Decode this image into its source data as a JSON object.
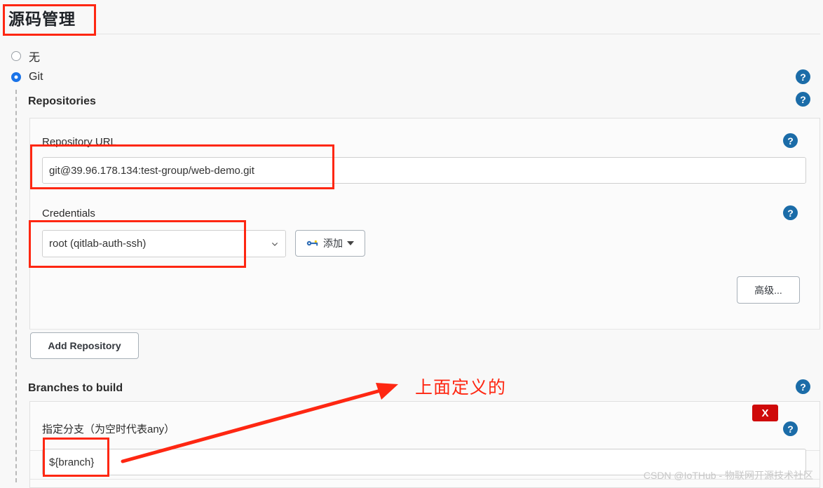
{
  "page": {
    "title": "源码管理",
    "watermark": "CSDN @IoTHub - 物联网开源技术社区"
  },
  "scm_options": [
    {
      "label": "无",
      "checked": false
    },
    {
      "label": "Git",
      "checked": true
    }
  ],
  "git": {
    "repositories_label": "Repositories",
    "repository": {
      "url_label": "Repository URL",
      "url_value": "git@39.96.178.134:test-group/web-demo.git",
      "credentials_label": "Credentials",
      "credentials_value": "root (qitlab-auth-ssh)",
      "add_credentials_label": "添加",
      "advanced_label": "高级...",
      "add_repository_label": "Add Repository"
    },
    "branches": {
      "section_label": "Branches to build",
      "branch_spec_label": "指定分支（为空时代表any）",
      "branch_spec_value": "${branch}",
      "delete_label": "X"
    }
  },
  "annotations": {
    "note_text": "上面定义的"
  },
  "icons": {
    "help": "?",
    "key": "key-icon",
    "caret": "chevron-down-icon"
  },
  "colors": {
    "accent": "#1a73e8",
    "annotation_red": "#fe2712",
    "help_blue": "#1b6ca8",
    "delete_red": "#cf0a0a"
  }
}
